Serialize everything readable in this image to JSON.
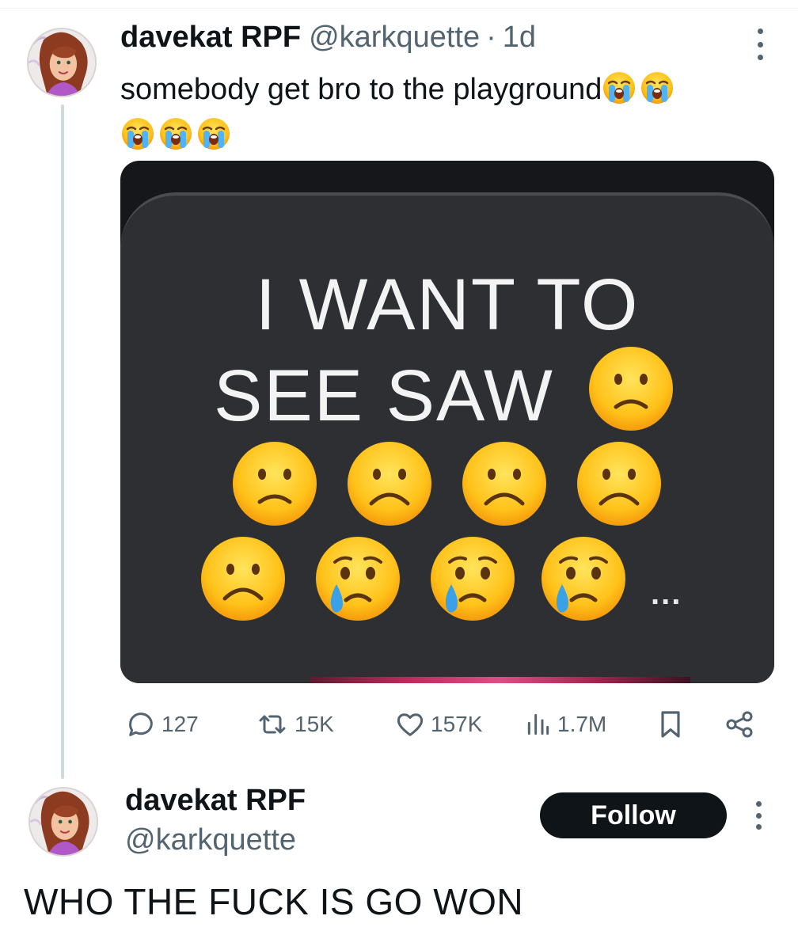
{
  "tweet": {
    "author_name": "davekat RPF",
    "handle": "@karkquette",
    "separator": "·",
    "time": "1d",
    "text": "somebody get bro to the playground",
    "trailing_emojis": [
      "loudly-crying-face",
      "loudly-crying-face",
      "loudly-crying-face",
      "loudly-crying-face",
      "loudly-crying-face"
    ],
    "media": {
      "line1": "I WANT TO",
      "line2": "SEE SAW",
      "emojis": [
        "slightly-frowning-face",
        "slightly-frowning-face",
        "frowning-face",
        "frowning-face",
        "frowning-face",
        "frowning-face",
        "crying-face",
        "crying-face",
        "crying-face"
      ],
      "ellipsis": "..."
    },
    "stats": {
      "replies": "127",
      "reposts": "15K",
      "likes": "157K",
      "views": "1.7M"
    }
  },
  "reply": {
    "author_name": "davekat RPF",
    "handle": "@karkquette",
    "follow_label": "Follow",
    "text": "WHO THE FUCK IS GO WON"
  },
  "colors": {
    "text_primary": "#0f1419",
    "text_secondary": "#536471",
    "thread_line": "#cfd9de",
    "follow_bg": "#0f1419",
    "media_bg": "#2d2f33"
  }
}
